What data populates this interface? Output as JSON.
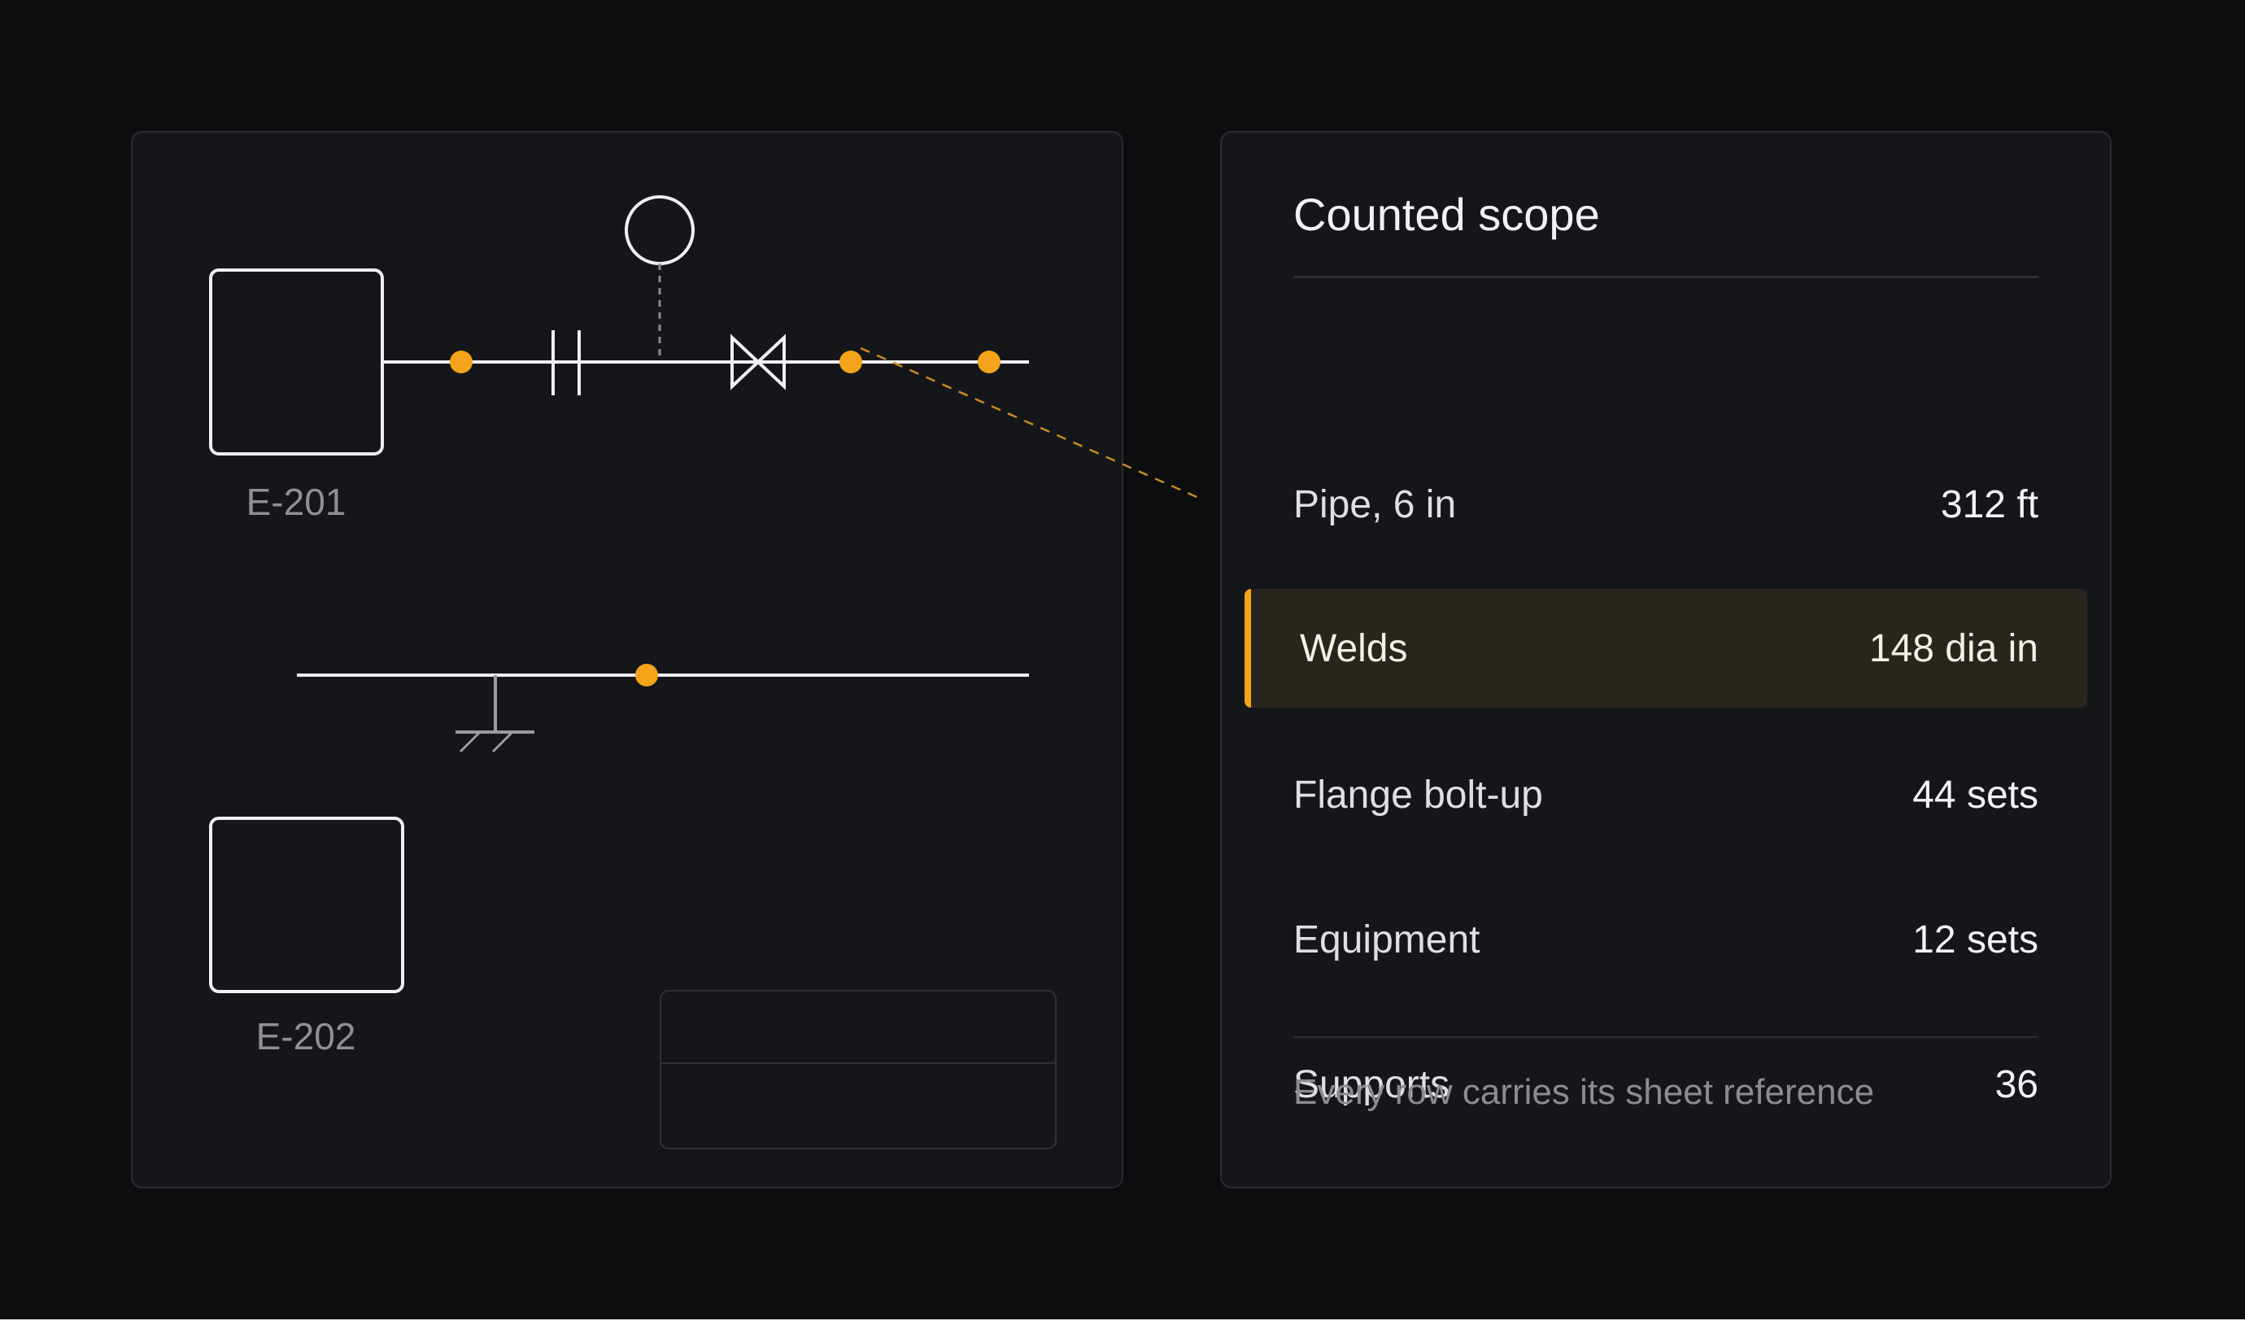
{
  "diagram": {
    "equipment": [
      {
        "tag": "E-201"
      },
      {
        "tag": "E-202"
      }
    ],
    "accent_color": "#f5a31a"
  },
  "scope": {
    "title": "Counted scope",
    "rows": [
      {
        "label": "Pipe, 6 in",
        "value": "312 ft",
        "highlighted": false
      },
      {
        "label": "Welds",
        "value": "148 dia in",
        "highlighted": true
      },
      {
        "label": "Flange bolt-up",
        "value": "44 sets",
        "highlighted": false
      },
      {
        "label": "Equipment",
        "value": "12 sets",
        "highlighted": false
      },
      {
        "label": "Supports",
        "value": "36",
        "highlighted": false
      }
    ],
    "footnote": "Every row carries its sheet reference"
  }
}
